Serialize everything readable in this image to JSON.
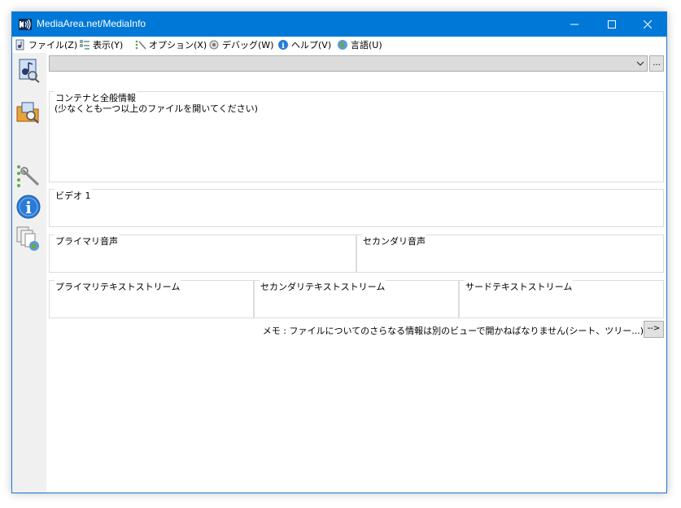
{
  "window": {
    "title": "MediaArea.net/MediaInfo"
  },
  "menu": [
    {
      "label": "ファイル(Z)",
      "icon": "file-icon"
    },
    {
      "label": "表示(Y)",
      "icon": "view-icon"
    },
    {
      "label": "オプション(X)",
      "icon": "options-icon"
    },
    {
      "label": "デバッグ(W)",
      "icon": "debug-icon"
    },
    {
      "label": "ヘルプ(V)",
      "icon": "help-icon"
    },
    {
      "label": "言語(U)",
      "icon": "language-icon"
    }
  ],
  "toolbar": {
    "browse_label": "..."
  },
  "groups": {
    "general": {
      "label": "コンテナと全般情報",
      "content": "(少なくとも一つ以上のファイルを開いてください)"
    },
    "video": {
      "label": "ビデオ 1"
    },
    "audio_primary": {
      "label": "プライマリ音声"
    },
    "audio_secondary": {
      "label": "セカンダリ音声"
    },
    "text_primary": {
      "label": "プライマリテキストストリーム"
    },
    "text_secondary": {
      "label": "セカンダリテキストストリーム"
    },
    "text_third": {
      "label": "サードテキストストリーム"
    }
  },
  "footer": {
    "memo": "メモ : ファイルについてのさらなる情報は別のビューで開かねばなりません(シート、ツリー...)",
    "arrow_label": "-->"
  },
  "colors": {
    "titlebar": "#0078d7",
    "sidebar": "#f0f0f0",
    "group_border": "#dcdcdc"
  }
}
